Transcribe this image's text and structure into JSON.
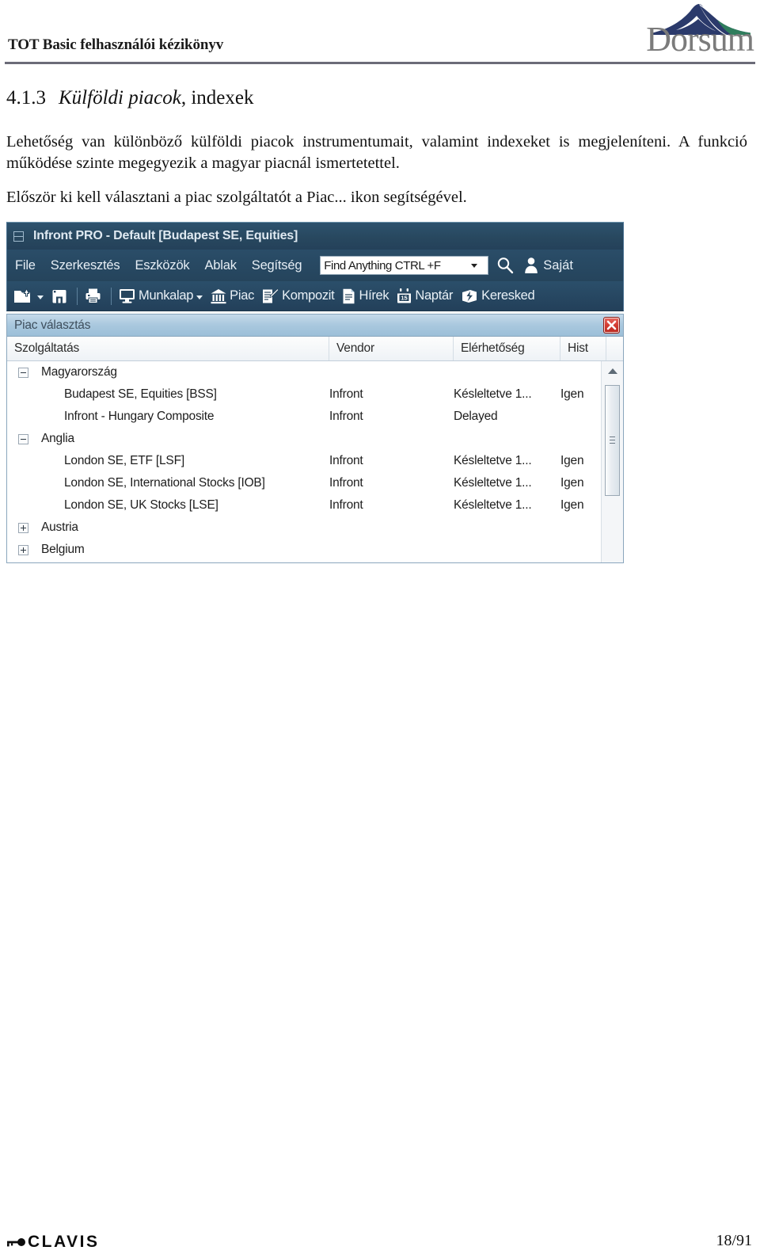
{
  "document": {
    "header_title": "TOT Basic felhasználói kézikönyv",
    "brand_logo": "Dorsum",
    "brand_logo_icon": "mountain-icon",
    "section_number": "4.1.3",
    "section_title_italic": "Külföldi piacok",
    "section_title_roman": ", indexek",
    "paragraph_1": "Lehetőség van különböző külföldi piacok instrumentumait, valamint indexeket is megjeleníteni. A funkció működése szinte megegyezik a magyar piacnál ismertetettel.",
    "paragraph_2": "Először ki kell választani a piac szolgáltatót a Piac... ikon segítségével.",
    "footer_logo": "CLAVIS",
    "footer_logo_icon": "key-icon",
    "page_number": "18/91"
  },
  "app": {
    "window_title": "Infront PRO - Default [Budapest SE, Equities]",
    "system_icon": "window-menu-icon",
    "menus": [
      {
        "label": "File"
      },
      {
        "label": "Szerkesztés"
      },
      {
        "label": "Eszközök"
      },
      {
        "label": "Ablak"
      },
      {
        "label": "Segítség"
      }
    ],
    "search": {
      "value": "Find Anything CTRL +F",
      "placeholder": "Find Anything CTRL +F",
      "dropdown_icon": "chevron-down-icon",
      "search_icon": "search-icon"
    },
    "user": {
      "icon": "person-icon",
      "label": "Saját"
    },
    "toolbar": {
      "icon_buttons": [
        {
          "name": "open-folder-button",
          "icon": "folder-open-icon",
          "has_caret": true
        },
        {
          "name": "save-button",
          "icon": "floppy-disk-icon",
          "has_caret": false
        },
        {
          "name": "print-button",
          "icon": "printer-icon",
          "has_caret": false
        }
      ],
      "items": [
        {
          "label": "Munkalap",
          "icon": "monitor-icon",
          "has_caret": true
        },
        {
          "label": "Piac",
          "icon": "bank-building-icon",
          "has_caret": false
        },
        {
          "label": "Kompozit",
          "icon": "document-pencil-icon",
          "has_caret": false
        },
        {
          "label": "Hírek",
          "icon": "news-document-icon",
          "has_caret": false
        },
        {
          "label": "Naptár",
          "icon": "calendar-icon",
          "calendar_day": "15",
          "has_caret": false
        },
        {
          "label": "Keresked",
          "icon": "trade-lightning-icon",
          "has_caret": false
        }
      ]
    },
    "panel": {
      "title": "Piac választás",
      "close_icon": "close-icon",
      "columns": [
        {
          "label": "Szolgáltatás"
        },
        {
          "label": "Vendor"
        },
        {
          "label": "Elérhetőség"
        },
        {
          "label": "Hist"
        }
      ],
      "rows": [
        {
          "type": "group",
          "expanded": true,
          "service": "Magyarország",
          "vendor": "",
          "availability": "",
          "hist": ""
        },
        {
          "type": "child",
          "expanded": null,
          "service": "Budapest SE, Equities [BSS]",
          "vendor": "Infront",
          "availability": "Késleltetve 1...",
          "hist": "Igen"
        },
        {
          "type": "child",
          "expanded": null,
          "service": "Infront - Hungary Composite",
          "vendor": "Infront",
          "availability": "Delayed",
          "hist": ""
        },
        {
          "type": "group",
          "expanded": true,
          "service": "Anglia",
          "vendor": "",
          "availability": "",
          "hist": ""
        },
        {
          "type": "child",
          "expanded": null,
          "service": "London SE, ETF [LSF]",
          "vendor": "Infront",
          "availability": "Késleltetve 1...",
          "hist": "Igen"
        },
        {
          "type": "child",
          "expanded": null,
          "service": "London SE, International Stocks [IOB]",
          "vendor": "Infront",
          "availability": "Késleltetve 1...",
          "hist": "Igen"
        },
        {
          "type": "child",
          "expanded": null,
          "service": "London SE, UK Stocks [LSE]",
          "vendor": "Infront",
          "availability": "Késleltetve 1...",
          "hist": "Igen"
        },
        {
          "type": "group",
          "expanded": false,
          "service": "Austria",
          "vendor": "",
          "availability": "",
          "hist": ""
        },
        {
          "type": "group",
          "expanded": false,
          "service": "Belgium",
          "vendor": "",
          "availability": "",
          "hist": ""
        }
      ],
      "scrollbar": {
        "up_arrow_icon": "scroll-up-arrow-icon",
        "thumb_grip_icon": "scrollbar-grip-icon"
      }
    }
  },
  "colors": {
    "chrome_dark_blue": "#27455e",
    "panel_header_blue": "#a9c8de",
    "close_red": "#d33c32",
    "rule_gray": "#6b6b78",
    "logo_gray": "#7b7b7b",
    "logo_mark_navy": "#2b3a6b",
    "logo_mark_green": "#2f7d5c"
  }
}
